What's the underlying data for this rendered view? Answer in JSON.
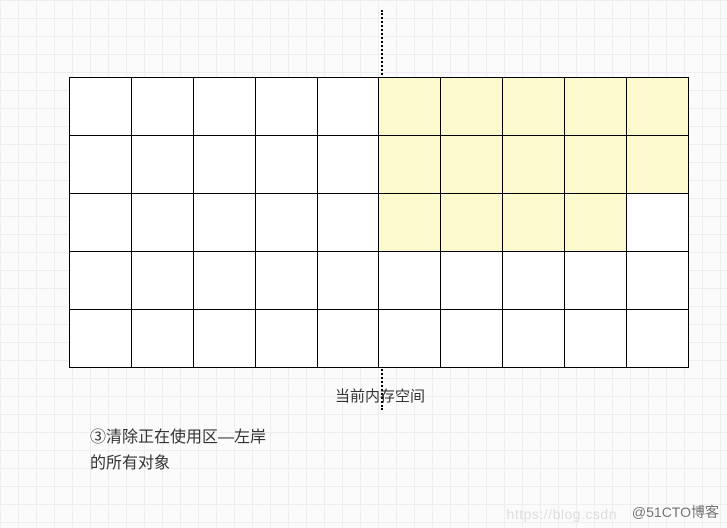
{
  "diagram": {
    "rows": 5,
    "cols_per_side": 5,
    "left_cells_filled": [],
    "right_cells_filled": [
      [
        0,
        0
      ],
      [
        0,
        1
      ],
      [
        0,
        2
      ],
      [
        0,
        3
      ],
      [
        0,
        4
      ],
      [
        1,
        0
      ],
      [
        1,
        1
      ],
      [
        1,
        2
      ],
      [
        1,
        3
      ],
      [
        1,
        4
      ],
      [
        2,
        0
      ],
      [
        2,
        1
      ],
      [
        2,
        2
      ],
      [
        2,
        3
      ]
    ]
  },
  "labels": {
    "divider_label": "当前内存空间",
    "caption_line1": "③清除正在使用区—左岸",
    "caption_line2": "的所有对象"
  },
  "watermark": {
    "left": "https://blog.csdn",
    "right": "@51CTO博客"
  }
}
